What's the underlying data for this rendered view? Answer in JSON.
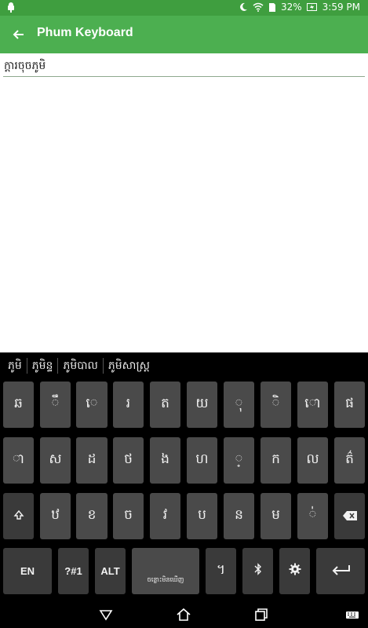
{
  "status_bar": {
    "battery_percent": "32%",
    "time": "3:59 PM",
    "icons": [
      "android-icon",
      "moon-icon",
      "wifi-icon",
      "sim-icon",
      "battery-charging-icon"
    ]
  },
  "app_bar": {
    "title": "Phum Keyboard",
    "back_icon": "arrow-left-icon"
  },
  "editor": {
    "value": "ក្តារចុចភូមិ"
  },
  "keyboard": {
    "suggestions": [
      "ភូមិ",
      "ភូមិន្ទ",
      "ភូមិបាល",
      "ភូមិសាស្ត្រ"
    ],
    "rows": [
      [
        "ឆ",
        "ឹ",
        "េ",
        "រ",
        "ត",
        "យ",
        "ុ",
        "ិ",
        "ោ",
        "ផ"
      ],
      [
        "ា",
        "ស",
        "ដ",
        "ថ",
        "ង",
        "ហ",
        "្",
        "ក",
        "ល",
        "ត៌"
      ],
      [
        "shift-icon",
        "ឋ",
        "ខ",
        "ច",
        "វ",
        "ប",
        "ន",
        "ម",
        "់",
        "backspace-icon"
      ],
      [
        "EN",
        "?#1",
        "ALT",
        "ចន្លោះមិនឃើញ",
        "។",
        "bluetooth-icon",
        "gear-icon",
        "enter-icon"
      ]
    ],
    "row1": [
      "ឆ",
      "ឹ",
      "េ",
      "រ",
      "ត",
      "យ",
      "ុ",
      "ិ",
      "ោ",
      "ផ"
    ],
    "row2": [
      "ា",
      "ស",
      "ដ",
      "ថ",
      "ង",
      "ហ",
      "្",
      "ក",
      "ល",
      "ត៌"
    ],
    "row3": [
      "ឋ",
      "ខ",
      "ច",
      "វ",
      "ប",
      "ន",
      "ម",
      "់"
    ],
    "row4": {
      "en": "EN",
      "sym": "?#1",
      "alt": "ALT",
      "space": "ចន្លោះមិនឃើញ",
      "khan": "។"
    }
  },
  "nav_bar": {
    "icons": [
      "back-triangle-icon",
      "home-icon",
      "recents-icon",
      "keyboard-icon"
    ]
  },
  "colors": {
    "status_bar": "#3f9e3f",
    "app_bar": "#4caf50",
    "keyboard_bg": "#000000",
    "key_bg": "#4a4a4a"
  }
}
